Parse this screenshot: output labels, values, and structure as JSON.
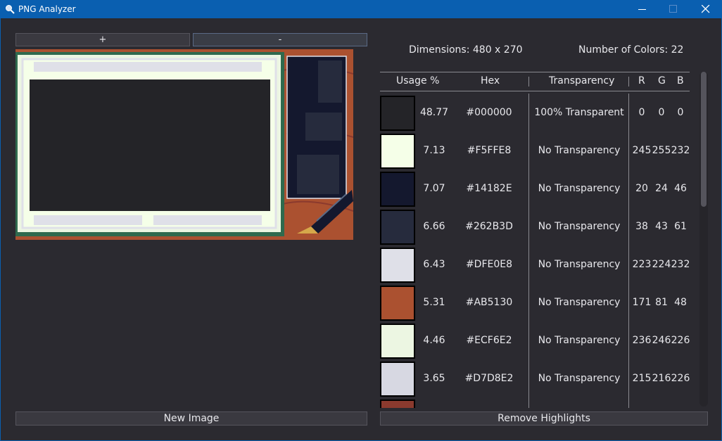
{
  "window": {
    "title": "PNG Analyzer"
  },
  "toolbar": {
    "zoom_in_label": "+",
    "zoom_out_label": "-"
  },
  "stats": {
    "dimensions": "Dimensions: 480 x 270",
    "num_colors": "Number of Colors: 22"
  },
  "table": {
    "headers": {
      "usage": "Usage %",
      "hex": "Hex",
      "transparency": "Transparency",
      "r": "R",
      "g": "G",
      "b": "B"
    },
    "rows": [
      {
        "color": "#242428",
        "usage": "48.77",
        "hex": "#000000",
        "transparency": "100% Transparent",
        "r": "0",
        "g": "0",
        "b": "0"
      },
      {
        "color": "#F5FFE8",
        "usage": "7.13",
        "hex": "#F5FFE8",
        "transparency": "No Transparency",
        "r": "245",
        "g": "255",
        "b": "232"
      },
      {
        "color": "#14182E",
        "usage": "7.07",
        "hex": "#14182E",
        "transparency": "No Transparency",
        "r": "20",
        "g": "24",
        "b": "46"
      },
      {
        "color": "#262B3D",
        "usage": "6.66",
        "hex": "#262B3D",
        "transparency": "No Transparency",
        "r": "38",
        "g": "43",
        "b": "61"
      },
      {
        "color": "#DFE0E8",
        "usage": "6.43",
        "hex": "#DFE0E8",
        "transparency": "No Transparency",
        "r": "223",
        "g": "224",
        "b": "232"
      },
      {
        "color": "#AB5130",
        "usage": "5.31",
        "hex": "#AB5130",
        "transparency": "No Transparency",
        "r": "171",
        "g": "81",
        "b": "48"
      },
      {
        "color": "#ECF6E2",
        "usage": "4.46",
        "hex": "#ECF6E2",
        "transparency": "No Transparency",
        "r": "236",
        "g": "246",
        "b": "226"
      },
      {
        "color": "#D7D8E2",
        "usage": "3.65",
        "hex": "#D7D8E2",
        "transparency": "No Transparency",
        "r": "215",
        "g": "216",
        "b": "226"
      },
      {
        "color": "#8B3A2E",
        "usage": "",
        "hex": "",
        "transparency": "",
        "r": "",
        "g": "",
        "b": ""
      }
    ]
  },
  "footer": {
    "new_image_label": "New Image",
    "remove_highlights_label": "Remove Highlights"
  },
  "colors": {
    "titlebar": "#0a5fb0",
    "background": "#2b2a30"
  }
}
